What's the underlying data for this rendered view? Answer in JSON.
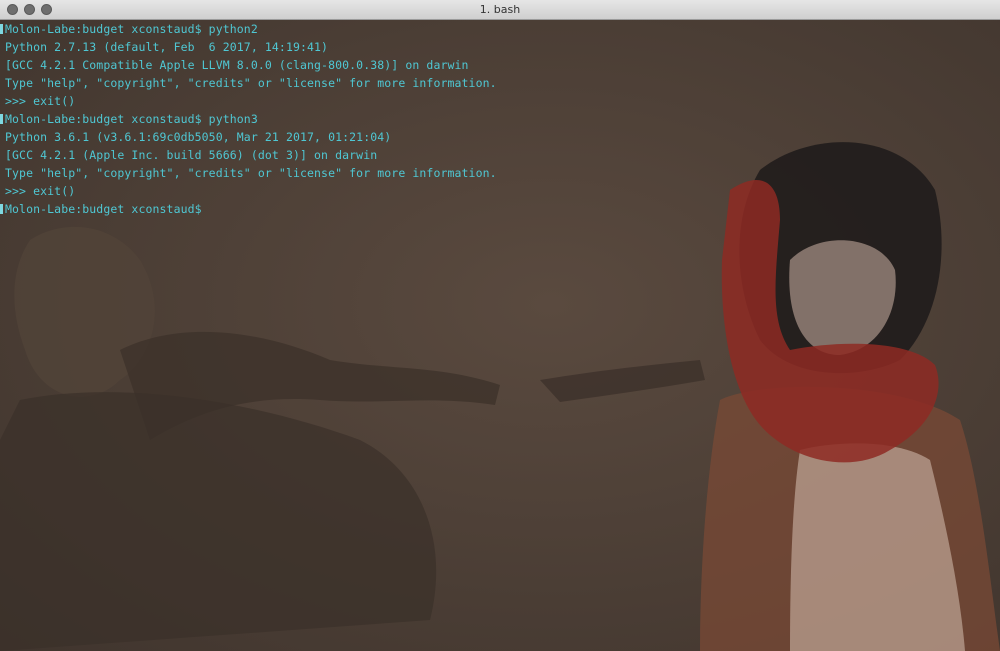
{
  "window": {
    "title": "1. bash"
  },
  "terminal": {
    "lines": [
      "Molon-Labe:budget xconstaud$ python2",
      "Python 2.7.13 (default, Feb  6 2017, 14:19:41)",
      "[GCC 4.2.1 Compatible Apple LLVM 8.0.0 (clang-800.0.38)] on darwin",
      "Type \"help\", \"copyright\", \"credits\" or \"license\" for more information.",
      ">>> exit()",
      "Molon-Labe:budget xconstaud$ python3",
      "Python 3.6.1 (v3.6.1:69c0db5050, Mar 21 2017, 01:21:04)",
      "[GCC 4.2.1 (Apple Inc. build 5666) (dot 3)] on darwin",
      "Type \"help\", \"copyright\", \"credits\" or \"license\" for more information.",
      ">>> exit()",
      "Molon-Labe:budget xconstaud$"
    ]
  },
  "colors": {
    "text": "#4fc7d3",
    "background": "#4a3d34",
    "scarf": "#8e2a23"
  },
  "icons": {
    "close": "close-light-icon",
    "minimize": "minimize-light-icon",
    "zoom": "zoom-light-icon"
  }
}
